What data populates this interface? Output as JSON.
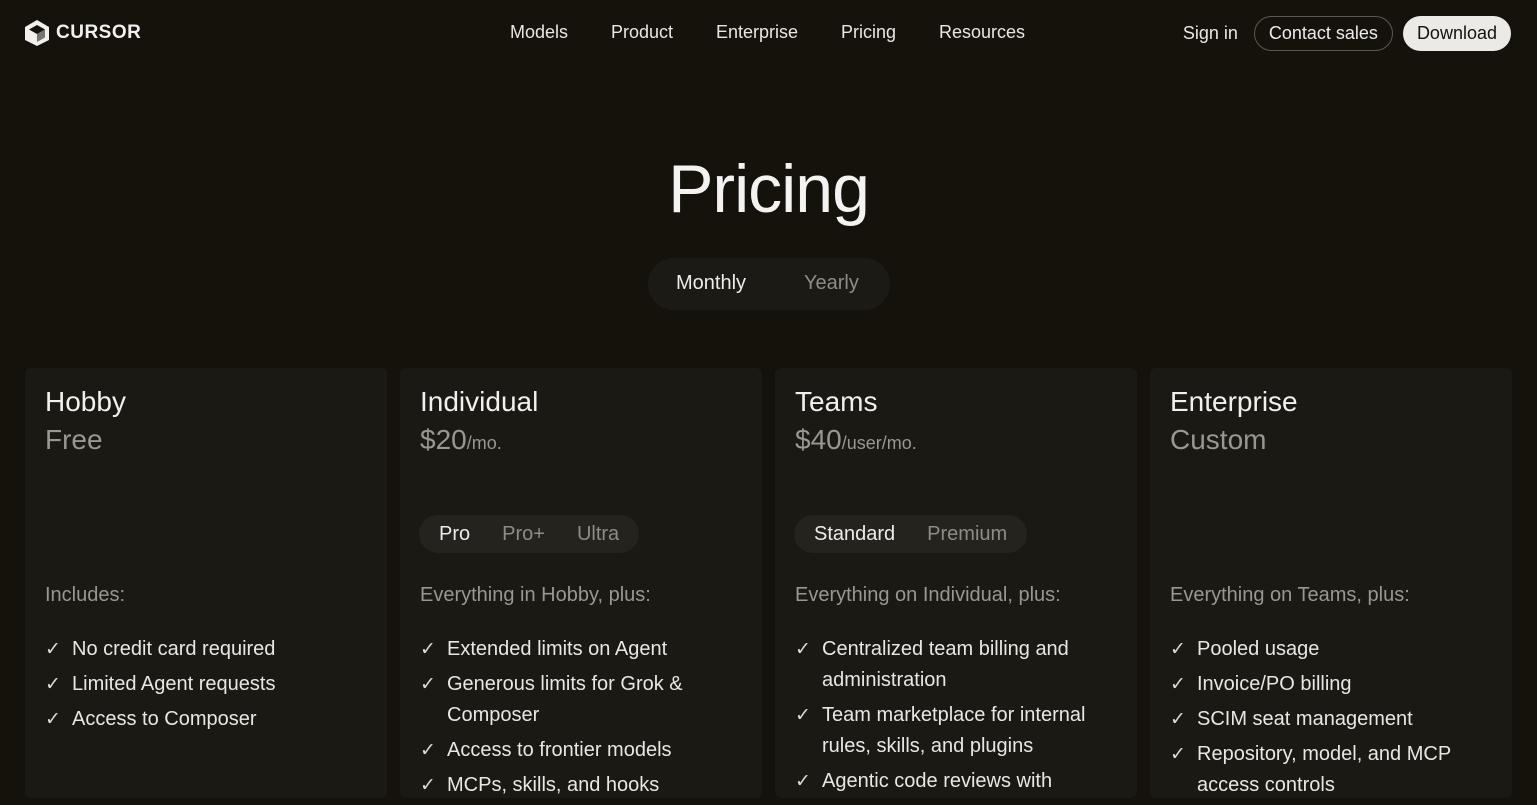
{
  "nav": {
    "logo_text": "CURSOR",
    "links": [
      "Models",
      "Product",
      "Enterprise",
      "Pricing",
      "Resources"
    ],
    "sign_in": "Sign in",
    "contact_sales": "Contact sales",
    "download": "Download"
  },
  "hero": {
    "title": "Pricing",
    "billing": {
      "monthly": "Monthly",
      "yearly": "Yearly",
      "selected": "Monthly"
    }
  },
  "plans": [
    {
      "name": "Hobby",
      "price": "Free",
      "unit": "",
      "options": [],
      "includes": "Includes:",
      "features": [
        "No credit card required",
        "Limited Agent requests",
        "Access to Composer"
      ]
    },
    {
      "name": "Individual",
      "price": "$20",
      "unit": "/mo.",
      "options": [
        "Pro",
        "Pro+",
        "Ultra"
      ],
      "selected_option": "Pro",
      "includes": "Everything in Hobby, plus:",
      "features": [
        "Extended limits on Agent",
        "Generous limits for Grok & Composer",
        "Access to frontier models",
        "MCPs, skills, and hooks"
      ]
    },
    {
      "name": "Teams",
      "price": "$40",
      "unit": "/user/mo.",
      "options": [
        "Standard",
        "Premium"
      ],
      "selected_option": "Standard",
      "includes": "Everything on Individual, plus:",
      "features": [
        "Centralized team billing and administration",
        "Team marketplace for internal rules, skills, and plugins",
        "Agentic code reviews with"
      ]
    },
    {
      "name": "Enterprise",
      "price": "Custom",
      "unit": "",
      "options": [],
      "includes": "Everything on Teams, plus:",
      "features": [
        "Pooled usage",
        "Invoice/PO billing",
        "SCIM seat management",
        "Repository, model, and MCP access controls"
      ]
    }
  ],
  "icons": {
    "check": "check-icon",
    "logo": "cursor-cube-logo"
  }
}
